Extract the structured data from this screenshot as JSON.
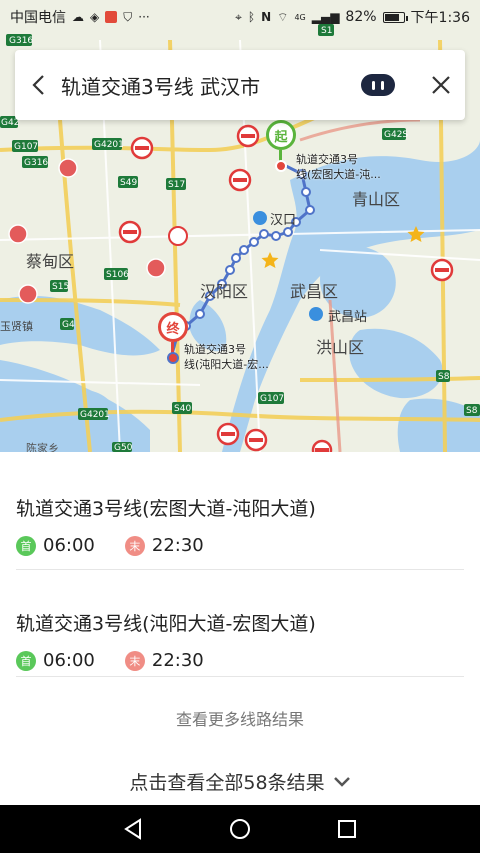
{
  "status_bar": {
    "carrier": "中国电信",
    "battery_percent": "82%",
    "battery_level": 0.82,
    "time": "下午1:36",
    "signal_label": "4G"
  },
  "search": {
    "title": "轨道交通3号线 武汉市"
  },
  "map": {
    "districts": [
      "蔡甸区",
      "汉阳区",
      "武昌区",
      "洪山区",
      "青山区"
    ],
    "stations": [
      "汉口",
      "武昌站"
    ],
    "town": "玉贤镇",
    "village": "陈家乡",
    "start_badge": "起",
    "end_badge": "终",
    "start_label_line1": "轨道交通3号",
    "start_label_line2": "线(宏图大道-沌...",
    "end_label_line1": "轨道交通3号",
    "end_label_line2": "线(沌阳大道-宏...",
    "road_labels": [
      "G316",
      "S1",
      "G42",
      "G107",
      "G4201",
      "G42S",
      "G316",
      "S49",
      "S17",
      "S15",
      "S106",
      "G4",
      "S8",
      "G4201",
      "S40",
      "G107",
      "G50",
      "S8"
    ],
    "colors": {
      "land": "#eef0e4",
      "water": "#a9cfee",
      "route": "#4f73c8",
      "start": "#5ab43c",
      "end": "#e2463c"
    }
  },
  "results": [
    {
      "title": "轨道交通3号线(宏图大道-沌阳大道)",
      "first_label": "首",
      "first_time": "06:00",
      "last_label": "末",
      "last_time": "22:30"
    },
    {
      "title": "轨道交通3号线(沌阳大道-宏图大道)",
      "first_label": "首",
      "first_time": "06:00",
      "last_label": "末",
      "last_time": "22:30"
    }
  ],
  "more_routes": "查看更多线路结果",
  "view_all": "点击查看全部58条结果"
}
